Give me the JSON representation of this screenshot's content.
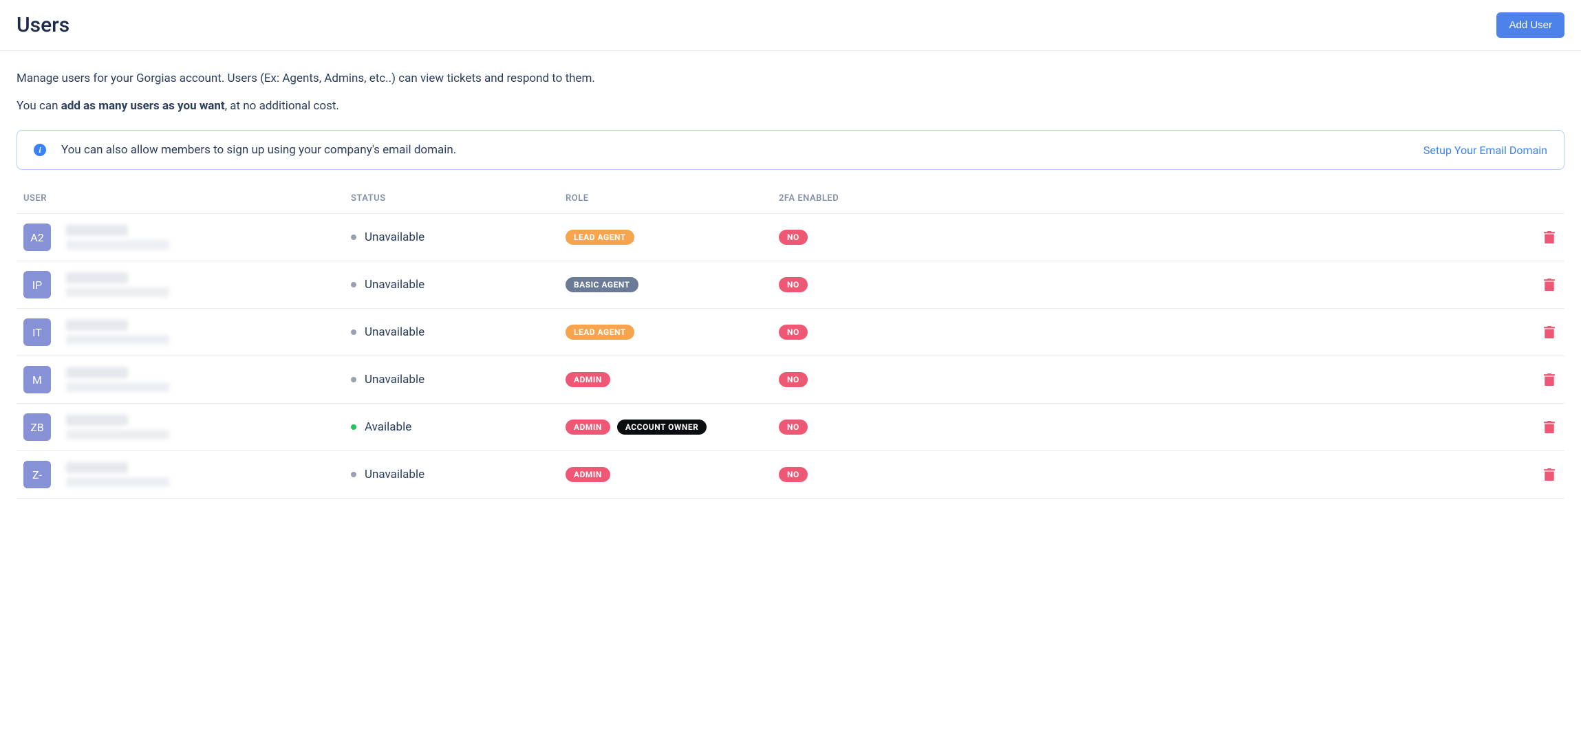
{
  "header": {
    "title": "Users",
    "add_button": "Add User"
  },
  "description": {
    "line1": "Manage users for your Gorgias account. Users (Ex: Agents, Admins, etc..) can view tickets and respond to them.",
    "line2_prefix": "You can ",
    "line2_bold": "add as many users as you want",
    "line2_suffix": ", at no additional cost."
  },
  "info_banner": {
    "text": "You can also allow members to sign up using your company's email domain.",
    "link": "Setup Your Email Domain"
  },
  "table": {
    "headers": {
      "user": "USER",
      "status": "STATUS",
      "role": "ROLE",
      "twofa": "2FA ENABLED"
    },
    "rows": [
      {
        "avatar": "A2",
        "status": "Unavailable",
        "status_kind": "unavailable",
        "roles": [
          {
            "label": "LEAD AGENT",
            "variant": "lead-agent"
          }
        ],
        "twofa": "NO"
      },
      {
        "avatar": "IP",
        "status": "Unavailable",
        "status_kind": "unavailable",
        "roles": [
          {
            "label": "BASIC AGENT",
            "variant": "basic-agent"
          }
        ],
        "twofa": "NO"
      },
      {
        "avatar": "IT",
        "status": "Unavailable",
        "status_kind": "unavailable",
        "roles": [
          {
            "label": "LEAD AGENT",
            "variant": "lead-agent"
          }
        ],
        "twofa": "NO"
      },
      {
        "avatar": "M",
        "status": "Unavailable",
        "status_kind": "unavailable",
        "roles": [
          {
            "label": "ADMIN",
            "variant": "admin"
          }
        ],
        "twofa": "NO"
      },
      {
        "avatar": "ZB",
        "status": "Available",
        "status_kind": "available",
        "roles": [
          {
            "label": "ADMIN",
            "variant": "admin"
          },
          {
            "label": "ACCOUNT OWNER",
            "variant": "owner"
          }
        ],
        "twofa": "NO"
      },
      {
        "avatar": "Z-",
        "status": "Unavailable",
        "status_kind": "unavailable",
        "roles": [
          {
            "label": "ADMIN",
            "variant": "admin"
          }
        ],
        "twofa": "NO"
      }
    ]
  }
}
